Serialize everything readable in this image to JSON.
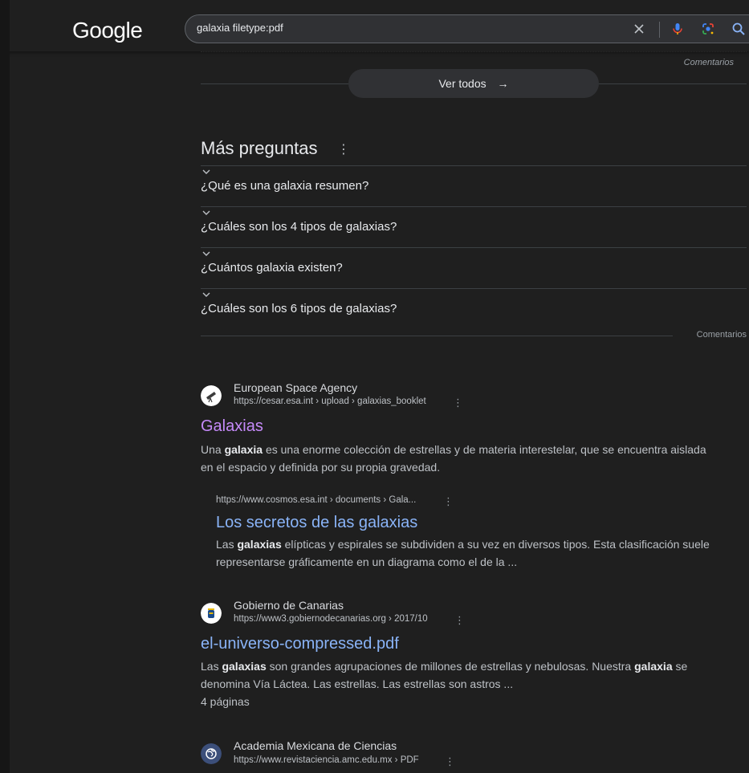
{
  "header": {
    "logo": "Google",
    "search_value": "galaxia filetype:pdf"
  },
  "top_section": {
    "comments_label": "Comentarios",
    "view_all_label": "Ver todos"
  },
  "more_questions": {
    "title": "Más preguntas",
    "items": [
      "¿Qué es una galaxia resumen?",
      "¿Cuáles son los 4 tipos de galaxias?",
      "¿Cuántos galaxia existen?",
      "¿Cuáles son los 6 tipos de galaxias?"
    ],
    "comments_label": "Comentarios"
  },
  "results": [
    {
      "site": "European Space Agency",
      "url": "https://cesar.esa.int › upload › galaxias_booklet",
      "title": "Galaxias",
      "snippet_parts": [
        "Una ",
        "galaxia",
        " es una enorme colección de estrellas y de materia interestelar, que se encuentra aislada en el espacio y definida por su propia gravedad."
      ],
      "sub": {
        "url": "https://www.cosmos.esa.int › documents › Gala...",
        "title": "Los secretos de las galaxias",
        "snippet_parts": [
          "Las ",
          "galaxias",
          " elípticas y espirales se subdividen a su vez en diversos tipos. Esta clasificación suele representarse gráficamente en un diagrama como el de la ..."
        ]
      }
    },
    {
      "site": "Gobierno de Canarias",
      "url": "https://www3.gobiernodecanarias.org › 2017/10",
      "title": "el-universo-compressed.pdf",
      "snippet_parts": [
        "Las ",
        "galaxias",
        " son grandes agrupaciones de millones de estrellas y nebulosas. Nuestra ",
        "galaxia",
        " se denomina Vía Láctea. Las estrellas. Las estrellas son astros ..."
      ],
      "extra": "4 páginas"
    },
    {
      "site": "Academia Mexicana de Ciencias",
      "url": "https://www.revistaciencia.amc.edu.mx › PDF"
    }
  ],
  "colors": {
    "background": "#1f1f1f",
    "link_visited": "#c58af9",
    "link": "#8ab4f8",
    "text": "#e8eaed",
    "muted": "#bdc1c6"
  }
}
